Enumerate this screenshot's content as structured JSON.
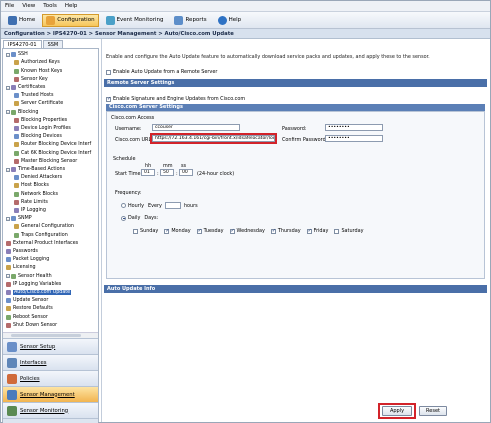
{
  "menu": [
    "File",
    "View",
    "Tools",
    "Help"
  ],
  "toolbar": {
    "home": "Home",
    "configuration": "Configuration",
    "event_monitoring": "Event Monitoring",
    "reports": "Reports",
    "help": "Help"
  },
  "breadcrumb": "Configuration > IPS4270-01 > Sensor Management > Auto/Cisco.com Update",
  "device_tabs": [
    "IPS4270-01",
    "SSM"
  ],
  "tree": [
    {
      "label": "SSH",
      "indent": 0,
      "expander": "-"
    },
    {
      "label": "Authorized Keys",
      "indent": 2
    },
    {
      "label": "Known Host Keys",
      "indent": 2
    },
    {
      "label": "Sensor Key",
      "indent": 2
    },
    {
      "label": "Certificates",
      "indent": 0,
      "expander": "-"
    },
    {
      "label": "Trusted Hosts",
      "indent": 2
    },
    {
      "label": "Server Certificate",
      "indent": 2
    },
    {
      "label": "Blocking",
      "indent": 0,
      "expander": "-"
    },
    {
      "label": "Blocking Properties",
      "indent": 2
    },
    {
      "label": "Device Login Profiles",
      "indent": 2
    },
    {
      "label": "Blocking Devices",
      "indent": 2
    },
    {
      "label": "Router Blocking Device Interf",
      "indent": 2
    },
    {
      "label": "Cat 6K Blocking Device Interf",
      "indent": 2
    },
    {
      "label": "Master Blocking Sensor",
      "indent": 2
    },
    {
      "label": "Time-Based Actions",
      "indent": 0,
      "expander": "-"
    },
    {
      "label": "Denied Attackers",
      "indent": 2
    },
    {
      "label": "Host Blocks",
      "indent": 2
    },
    {
      "label": "Network Blocks",
      "indent": 2
    },
    {
      "label": "Rate Limits",
      "indent": 2
    },
    {
      "label": "IP Logging",
      "indent": 2
    },
    {
      "label": "SNMP",
      "indent": 0,
      "expander": "-"
    },
    {
      "label": "General Configuration",
      "indent": 2
    },
    {
      "label": "Traps Configuration",
      "indent": 2
    },
    {
      "label": "External Product Interfaces",
      "indent": 0
    },
    {
      "label": "Passwords",
      "indent": 0
    },
    {
      "label": "Packet Logging",
      "indent": 0
    },
    {
      "label": "Licensing",
      "indent": 0
    },
    {
      "label": "Sensor Health",
      "indent": 0,
      "expander": "-"
    },
    {
      "label": "IP Logging Variables",
      "indent": 0
    },
    {
      "label": "Auto/Cisco.com Update",
      "indent": 0,
      "selected": true
    },
    {
      "label": "Update Sensor",
      "indent": 0
    },
    {
      "label": "Restore Defaults",
      "indent": 0
    },
    {
      "label": "Reboot Sensor",
      "indent": 0
    },
    {
      "label": "Shut Down Sensor",
      "indent": 0
    }
  ],
  "nav_buttons": [
    {
      "label": "Sensor Setup",
      "color": "#6a8fc8"
    },
    {
      "label": "Interfaces",
      "color": "#5f86b8"
    },
    {
      "label": "Policies",
      "color": "#d06a3a"
    },
    {
      "label": "Sensor Management",
      "color": "#4a7bbd",
      "active": true
    },
    {
      "label": "Sensor Monitoring",
      "color": "#5a8a52"
    }
  ],
  "main": {
    "description": "Enable and configure the Auto Update feature to automatically download service packs and updates, and apply these to the sensor.",
    "enable_remote": "Enable Auto Update from a Remote Server",
    "remote_section": "Remote Server Settings",
    "enable_cisco": "Enable Signature and Engine Updates from Cisco.com",
    "cisco_section": "Cisco.com Server Settings",
    "access_heading": "Cisco.com Access",
    "username_label": "Username:",
    "username_value": "ccouser",
    "password_label": "Password:",
    "password_value": "••••••••",
    "url_label": "Cisco.com URL:",
    "url_value": "https://72.163.4.161/cgi-bin/front.x/idsafelocator/locator.pl",
    "confirm_label": "Confirm Password:",
    "confirm_value": "••••••••",
    "schedule_heading": "Schedule",
    "time_header": {
      "hh": "hh",
      "mm": "mm",
      "ss": "ss"
    },
    "start_time_label": "Start Time:",
    "hh": "01",
    "mm": "50",
    "ss": "00",
    "clock_note": "(24-hour clock)",
    "frequency_heading": "Frequency:",
    "hourly": "Hourly",
    "every": "Every",
    "hours": "hours",
    "daily": "Daily",
    "days": "Days:",
    "weekdays": [
      {
        "label": "Sunday",
        "checked": false
      },
      {
        "label": "Monday",
        "checked": true
      },
      {
        "label": "Tuesday",
        "checked": true
      },
      {
        "label": "Wednesday",
        "checked": true
      },
      {
        "label": "Thursday",
        "checked": true
      },
      {
        "label": "Friday",
        "checked": true
      },
      {
        "label": "Saturday",
        "checked": false
      }
    ],
    "info_section": "Auto Update Info"
  },
  "buttons": {
    "apply": "Apply",
    "reset": "Reset"
  },
  "colors": {
    "highlight": "#d2232a",
    "section": "#4a6fa8",
    "selected": "#3166b6"
  }
}
